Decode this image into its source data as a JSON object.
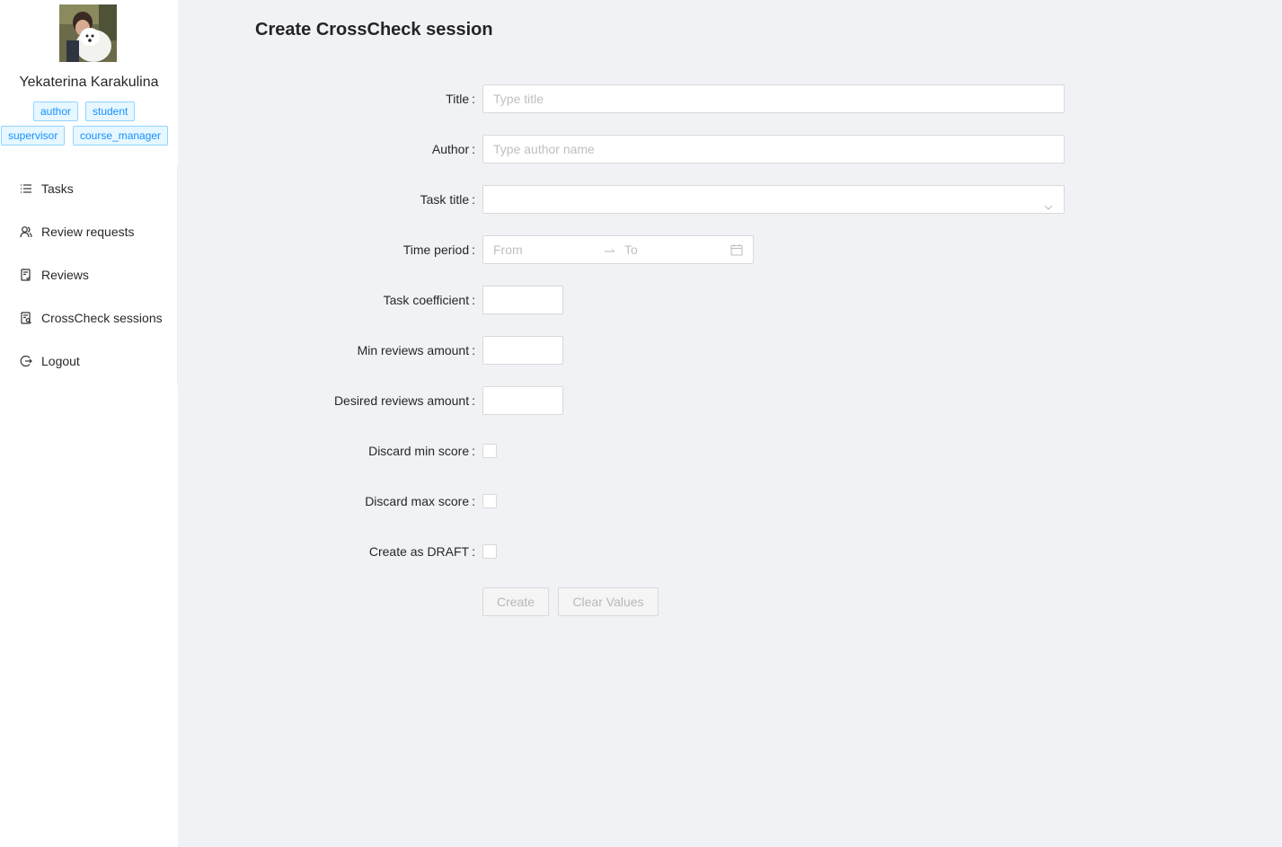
{
  "user": {
    "name": "Yekaterina Karakulina",
    "roles": [
      "author",
      "student",
      "supervisor",
      "course_manager"
    ]
  },
  "menu": {
    "items": [
      {
        "label": "Tasks",
        "icon": "list-icon"
      },
      {
        "label": "Review requests",
        "icon": "users-icon"
      },
      {
        "label": "Reviews",
        "icon": "file-check-icon"
      },
      {
        "label": "CrossCheck sessions",
        "icon": "file-search-icon"
      },
      {
        "label": "Logout",
        "icon": "logout-icon"
      }
    ]
  },
  "page": {
    "title": "Create CrossCheck session"
  },
  "form": {
    "title": {
      "label": "Title",
      "placeholder": "Type title",
      "value": ""
    },
    "author": {
      "label": "Author",
      "placeholder": "Type author name",
      "value": ""
    },
    "task_title": {
      "label": "Task title",
      "value": ""
    },
    "time_period": {
      "label": "Time period",
      "from_placeholder": "From",
      "to_placeholder": "To"
    },
    "task_coefficient": {
      "label": "Task coefficient",
      "value": ""
    },
    "min_reviews": {
      "label": "Min reviews amount",
      "value": ""
    },
    "desired_reviews": {
      "label": "Desired reviews amount",
      "value": ""
    },
    "discard_min": {
      "label": "Discard min score",
      "checked": false
    },
    "discard_max": {
      "label": "Discard max score",
      "checked": false
    },
    "draft": {
      "label": "Create as DRAFT",
      "checked": false
    },
    "create_label": "Create",
    "clear_label": "Clear Values",
    "colon": ":"
  },
  "colors": {
    "accent": "#1890ff",
    "tag_bg": "#e6f7ff",
    "tag_border": "#91d5ff",
    "page_bg": "#f0f2f5"
  }
}
